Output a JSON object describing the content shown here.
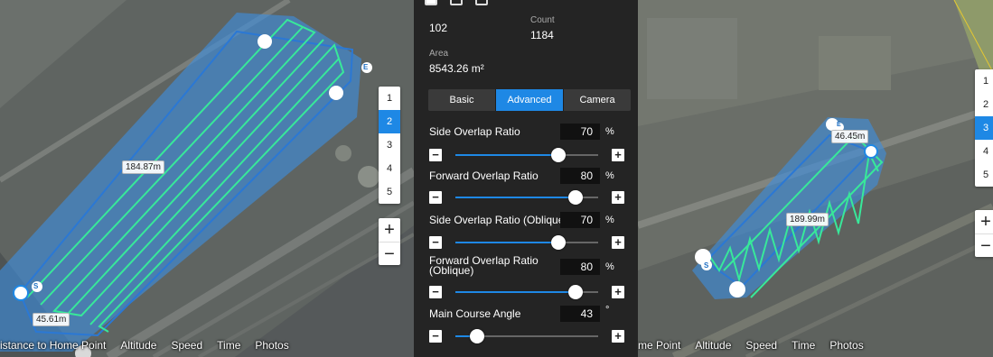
{
  "left_map": {
    "distance_long": "184.87m",
    "distance_short": "45.61m",
    "start_marker": "S",
    "end_marker": "E",
    "bottom_bar": [
      "istance to Home Point",
      "Altitude",
      "Speed",
      "Time",
      "Photos"
    ],
    "pager": [
      "1",
      "2",
      "3",
      "4",
      "5"
    ],
    "active_page": "2",
    "zoom_in": "+",
    "zoom_out": "−"
  },
  "panel": {
    "stat1_value": "102",
    "count_label": "Count",
    "count_value": "1184",
    "area_label": "Area",
    "area_value": "8543.26 m²",
    "tabs": [
      "Basic",
      "Advanced",
      "Camera"
    ],
    "active_tab": "Advanced",
    "settings": [
      {
        "label": "Side Overlap Ratio",
        "value": "70",
        "unit": "%",
        "level": 0.72
      },
      {
        "label": "Forward Overlap Ratio",
        "value": "80",
        "unit": "%",
        "level": 0.84
      },
      {
        "label": "Side Overlap Ratio (Oblique)",
        "value": "70",
        "unit": "%",
        "level": 0.72
      },
      {
        "label": "Forward Overlap Ratio (Oblique)",
        "value": "80",
        "unit": "%",
        "level": 0.84
      },
      {
        "label": "Main Course Angle",
        "value": "43",
        "unit": "°",
        "level": 0.15
      }
    ],
    "minus": "−",
    "plus": "+"
  },
  "right_map": {
    "distance_short": "46.45m",
    "distance_long": "189.99m",
    "start_marker": "S",
    "end_marker": "E",
    "bottom_bar": [
      "me Point",
      "Altitude",
      "Speed",
      "Time",
      "Photos"
    ],
    "pager": [
      "1",
      "2",
      "3",
      "4",
      "5"
    ],
    "active_page": "3",
    "zoom_in": "+",
    "zoom_out": "−"
  },
  "colors": {
    "accent": "#1e88e5",
    "coverage": "#3d8ede",
    "route": "#38e89a",
    "panel_bg": "#242424"
  }
}
